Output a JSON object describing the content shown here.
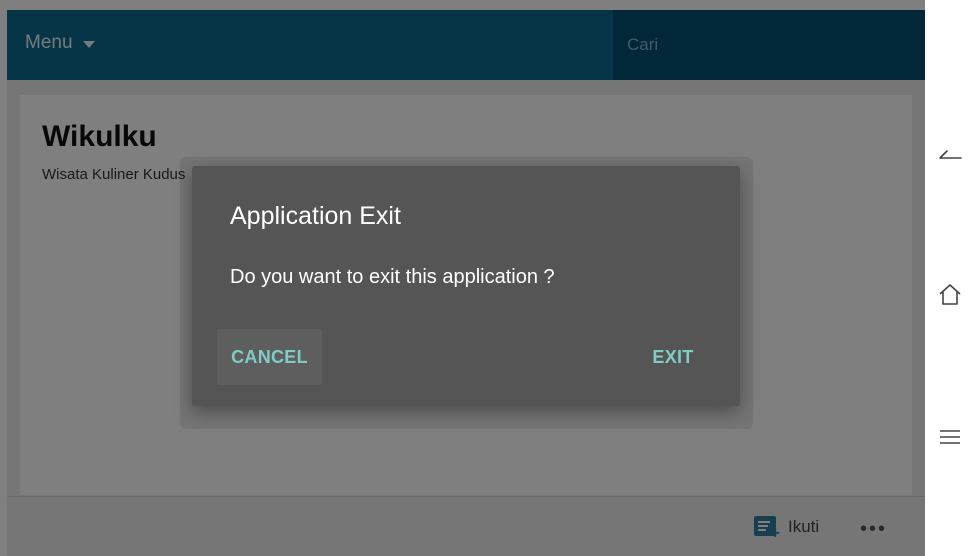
{
  "header": {
    "menu_label": "Menu",
    "search_placeholder": "Cari"
  },
  "page": {
    "title": "Wikulku",
    "subtitle": "Wisata Kuliner Kudus"
  },
  "bottom_bar": {
    "follow_label": "Ikuti",
    "more_label": "•••"
  },
  "dialog": {
    "title": "Application Exit",
    "message": "Do you want to exit this application ?",
    "cancel_label": "CANCEL",
    "exit_label": "EXIT"
  },
  "navbar": {
    "icons": [
      "back-icon",
      "home-icon",
      "recent-apps-icon"
    ]
  },
  "colors": {
    "header_bg": "#0a6b8f",
    "search_bg": "#054f70",
    "dialog_bg": "#555555",
    "accent": "#80cbc4"
  }
}
